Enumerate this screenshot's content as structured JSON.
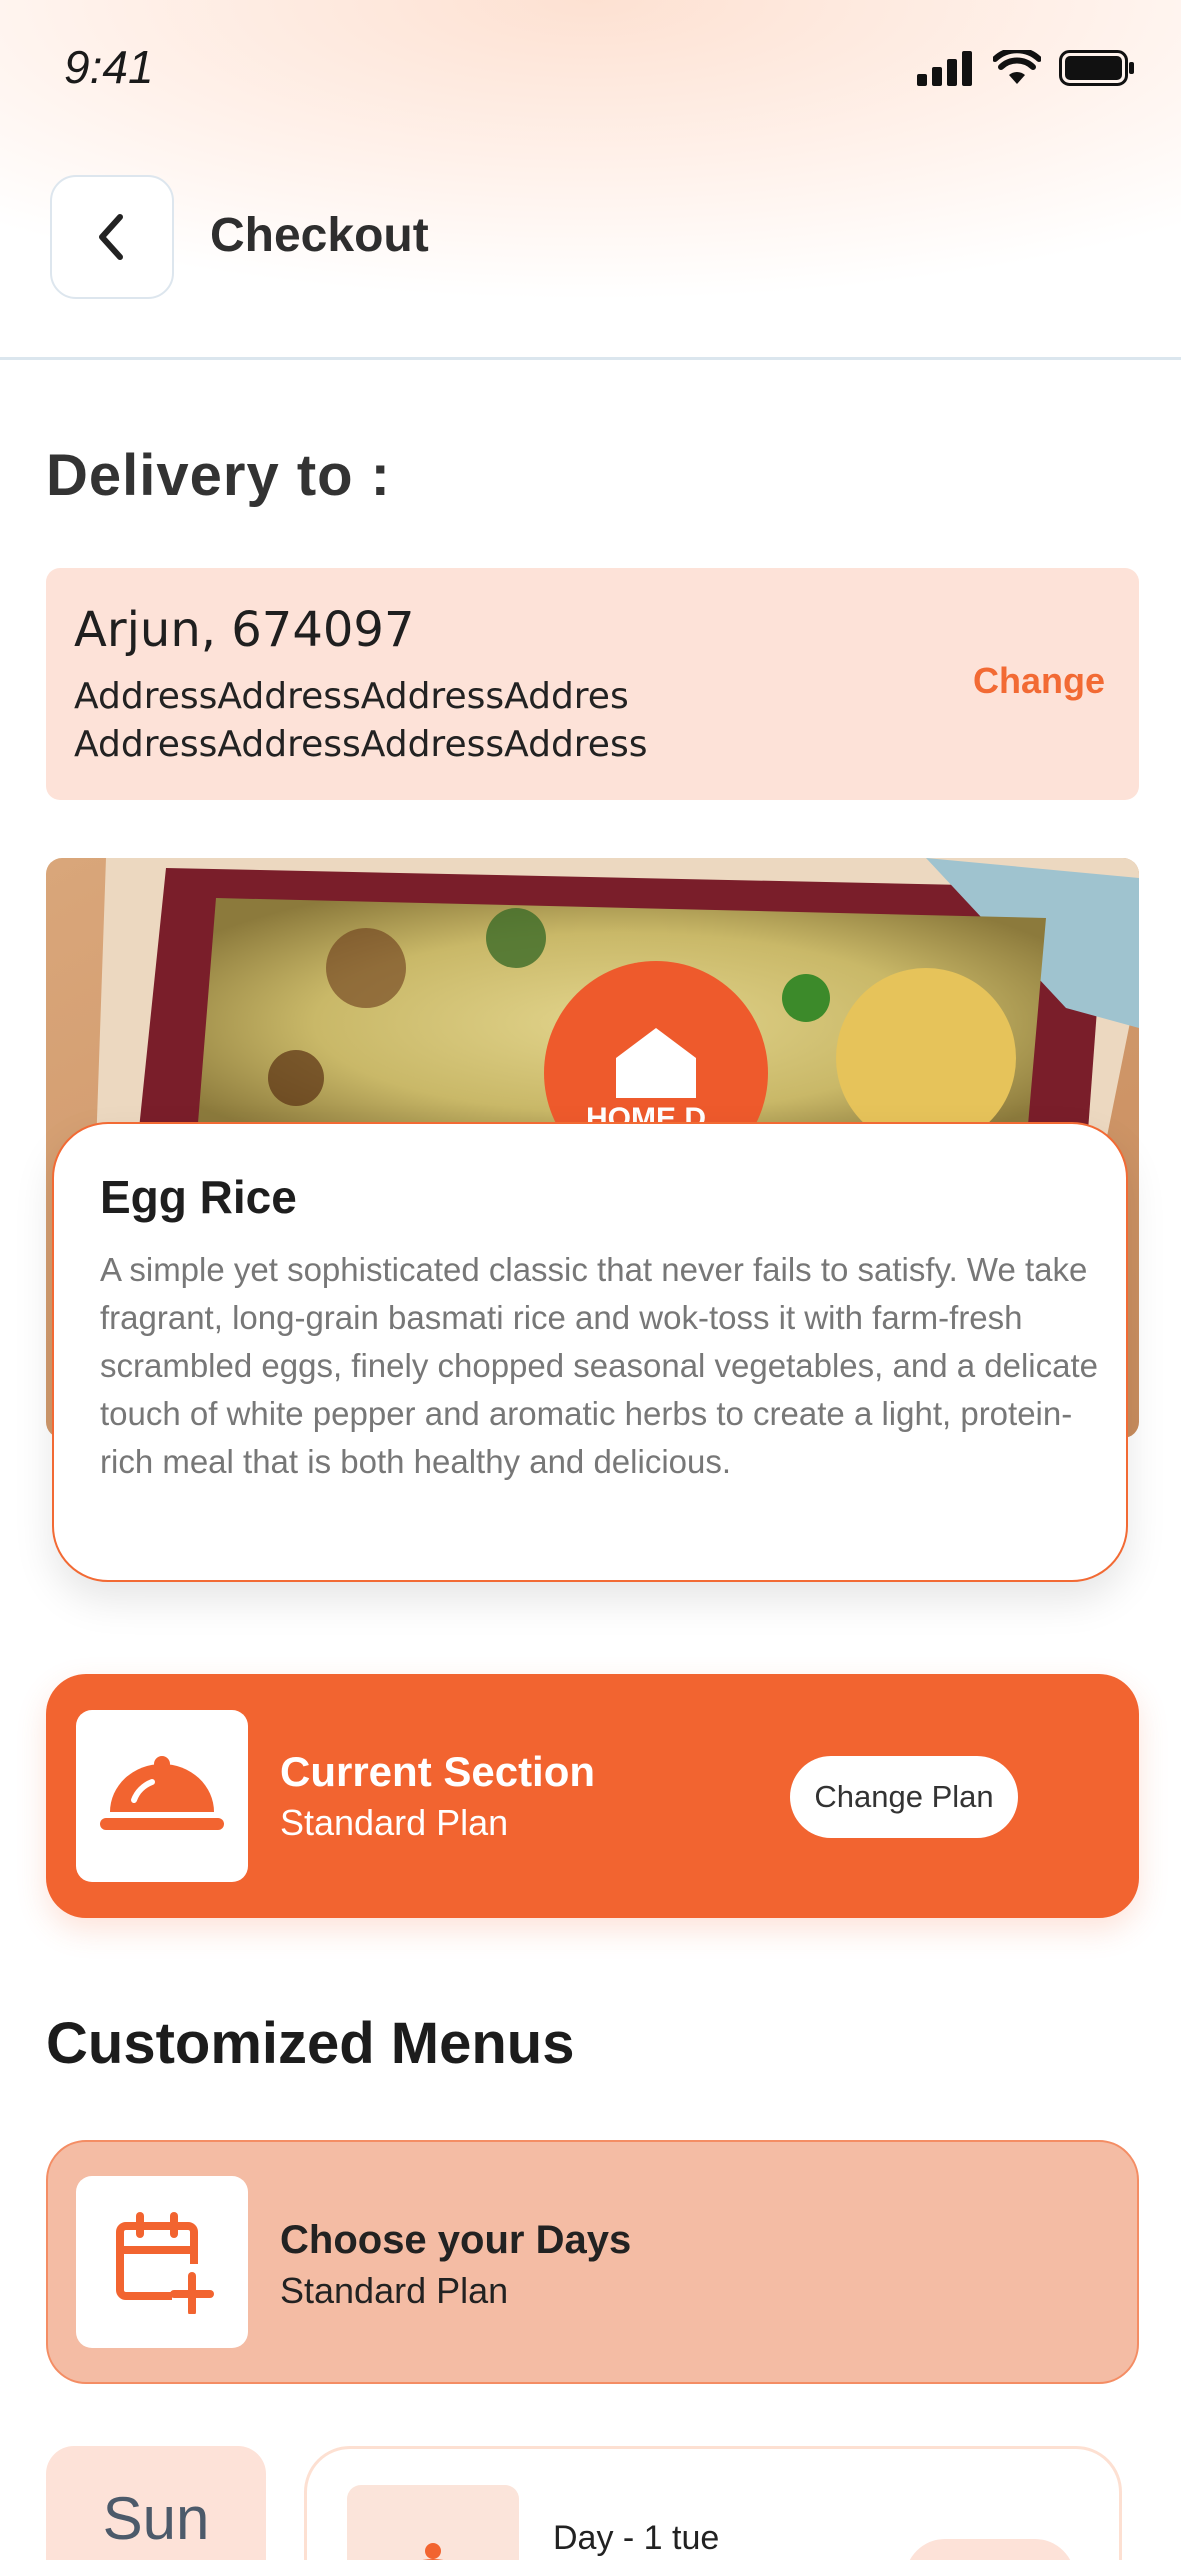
{
  "status_bar": {
    "time": "9:41"
  },
  "header": {
    "title": "Checkout"
  },
  "delivery": {
    "heading": "Delivery to :",
    "name": "Arjun, 674097",
    "address_line1": "AddressAddressAddressAddres",
    "address_line2": "AddressAddressAddressAddress",
    "change_label": "Change"
  },
  "food_image": {
    "badge_text": "HOME D"
  },
  "dish": {
    "name": "Egg Rice",
    "description": "A simple yet sophisticated classic that never fails to satisfy. We take fragrant, long-grain basmati rice and wok-toss it with farm-fresh scrambled eggs, finely chopped seasonal vegetables, and a delicate touch of white pepper and aromatic herbs to create a light, protein-rich meal that is both healthy and delicious."
  },
  "plan": {
    "title": "Current Section",
    "subtitle": "Standard Plan",
    "change_label": "Change Plan",
    "icon": "food-cloche-icon"
  },
  "menus": {
    "heading": "Customized Menus",
    "choose_days": {
      "title": "Choose your Days",
      "subtitle": "Standard Plan",
      "icon": "calendar-add-icon"
    },
    "day_selector": {
      "label": "Sun"
    },
    "day_card": {
      "label": "Day - 1 tue"
    }
  },
  "colors": {
    "accent": "#f26430",
    "accent_light": "#fde2d8",
    "accent_mid": "#f4bca4",
    "text_dark": "#222222",
    "text_muted": "#777777"
  }
}
